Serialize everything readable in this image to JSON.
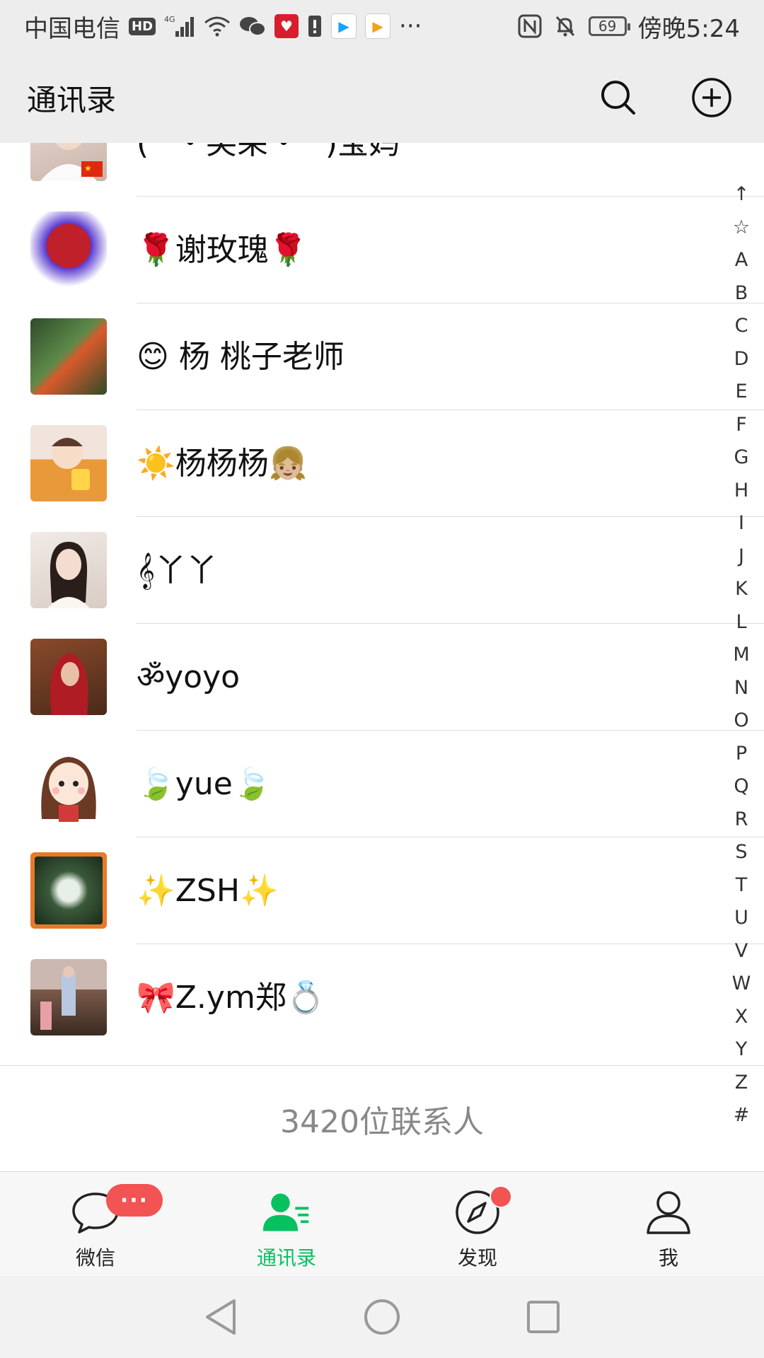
{
  "status_bar": {
    "carrier": "中国电信",
    "hd": "HD",
    "signal_label": "4G",
    "battery_level": "69",
    "time": "傍晚5:24",
    "more": "···",
    "icons": [
      "hd-icon",
      "signal-icon",
      "wifi-icon",
      "wechat-icon",
      "heart-app-icon",
      "alert-icon",
      "youku-icon",
      "video-app-icon",
      "nfc-icon",
      "mute-icon",
      "battery-icon"
    ]
  },
  "header": {
    "title": "通讯录",
    "search_icon": "search-icon",
    "add_icon": "add-circle-icon"
  },
  "contacts": [
    {
      "name": "(^・笑朵・^)宝妈",
      "avatar_color": "#d9c8c0"
    },
    {
      "name": "🌹谢玫瑰🌹",
      "avatar_color": "#c0202a"
    },
    {
      "name": "😊 杨  桃子老师",
      "avatar_color": "#3f6a3a"
    },
    {
      "name": "☀️杨杨杨👧🏼",
      "avatar_color": "#e8a04a"
    },
    {
      "name": "𝄞丫丫",
      "avatar_color": "#e6d6cc"
    },
    {
      "name": "ॐyoyo",
      "avatar_color": "#7a2a20"
    },
    {
      "name": "🍃yue🍃",
      "avatar_color": "#f2e6d8"
    },
    {
      "name": "✨ZSH✨",
      "avatar_color": "#e67a2a"
    },
    {
      "name": "🎀Z.ym郑💍",
      "avatar_color": "#9a7a6a"
    }
  ],
  "contact_count": "3420位联系人",
  "index_letters": [
    "↑",
    "☆",
    "A",
    "B",
    "C",
    "D",
    "E",
    "F",
    "G",
    "H",
    "I",
    "J",
    "K",
    "L",
    "M",
    "N",
    "O",
    "P",
    "Q",
    "R",
    "S",
    "T",
    "U",
    "V",
    "W",
    "X",
    "Y",
    "Z",
    "#"
  ],
  "tabs": [
    {
      "label": "微信",
      "icon": "chat-bubble-icon",
      "badge": "···"
    },
    {
      "label": "通讯录",
      "icon": "contacts-icon",
      "active": true
    },
    {
      "label": "发现",
      "icon": "compass-icon",
      "dot": true
    },
    {
      "label": "我",
      "icon": "person-icon"
    }
  ],
  "nav": [
    "back-icon",
    "home-icon",
    "recents-icon"
  ],
  "colors": {
    "accent": "#07c160",
    "badge": "#f25353",
    "header_bg": "#ededed"
  }
}
